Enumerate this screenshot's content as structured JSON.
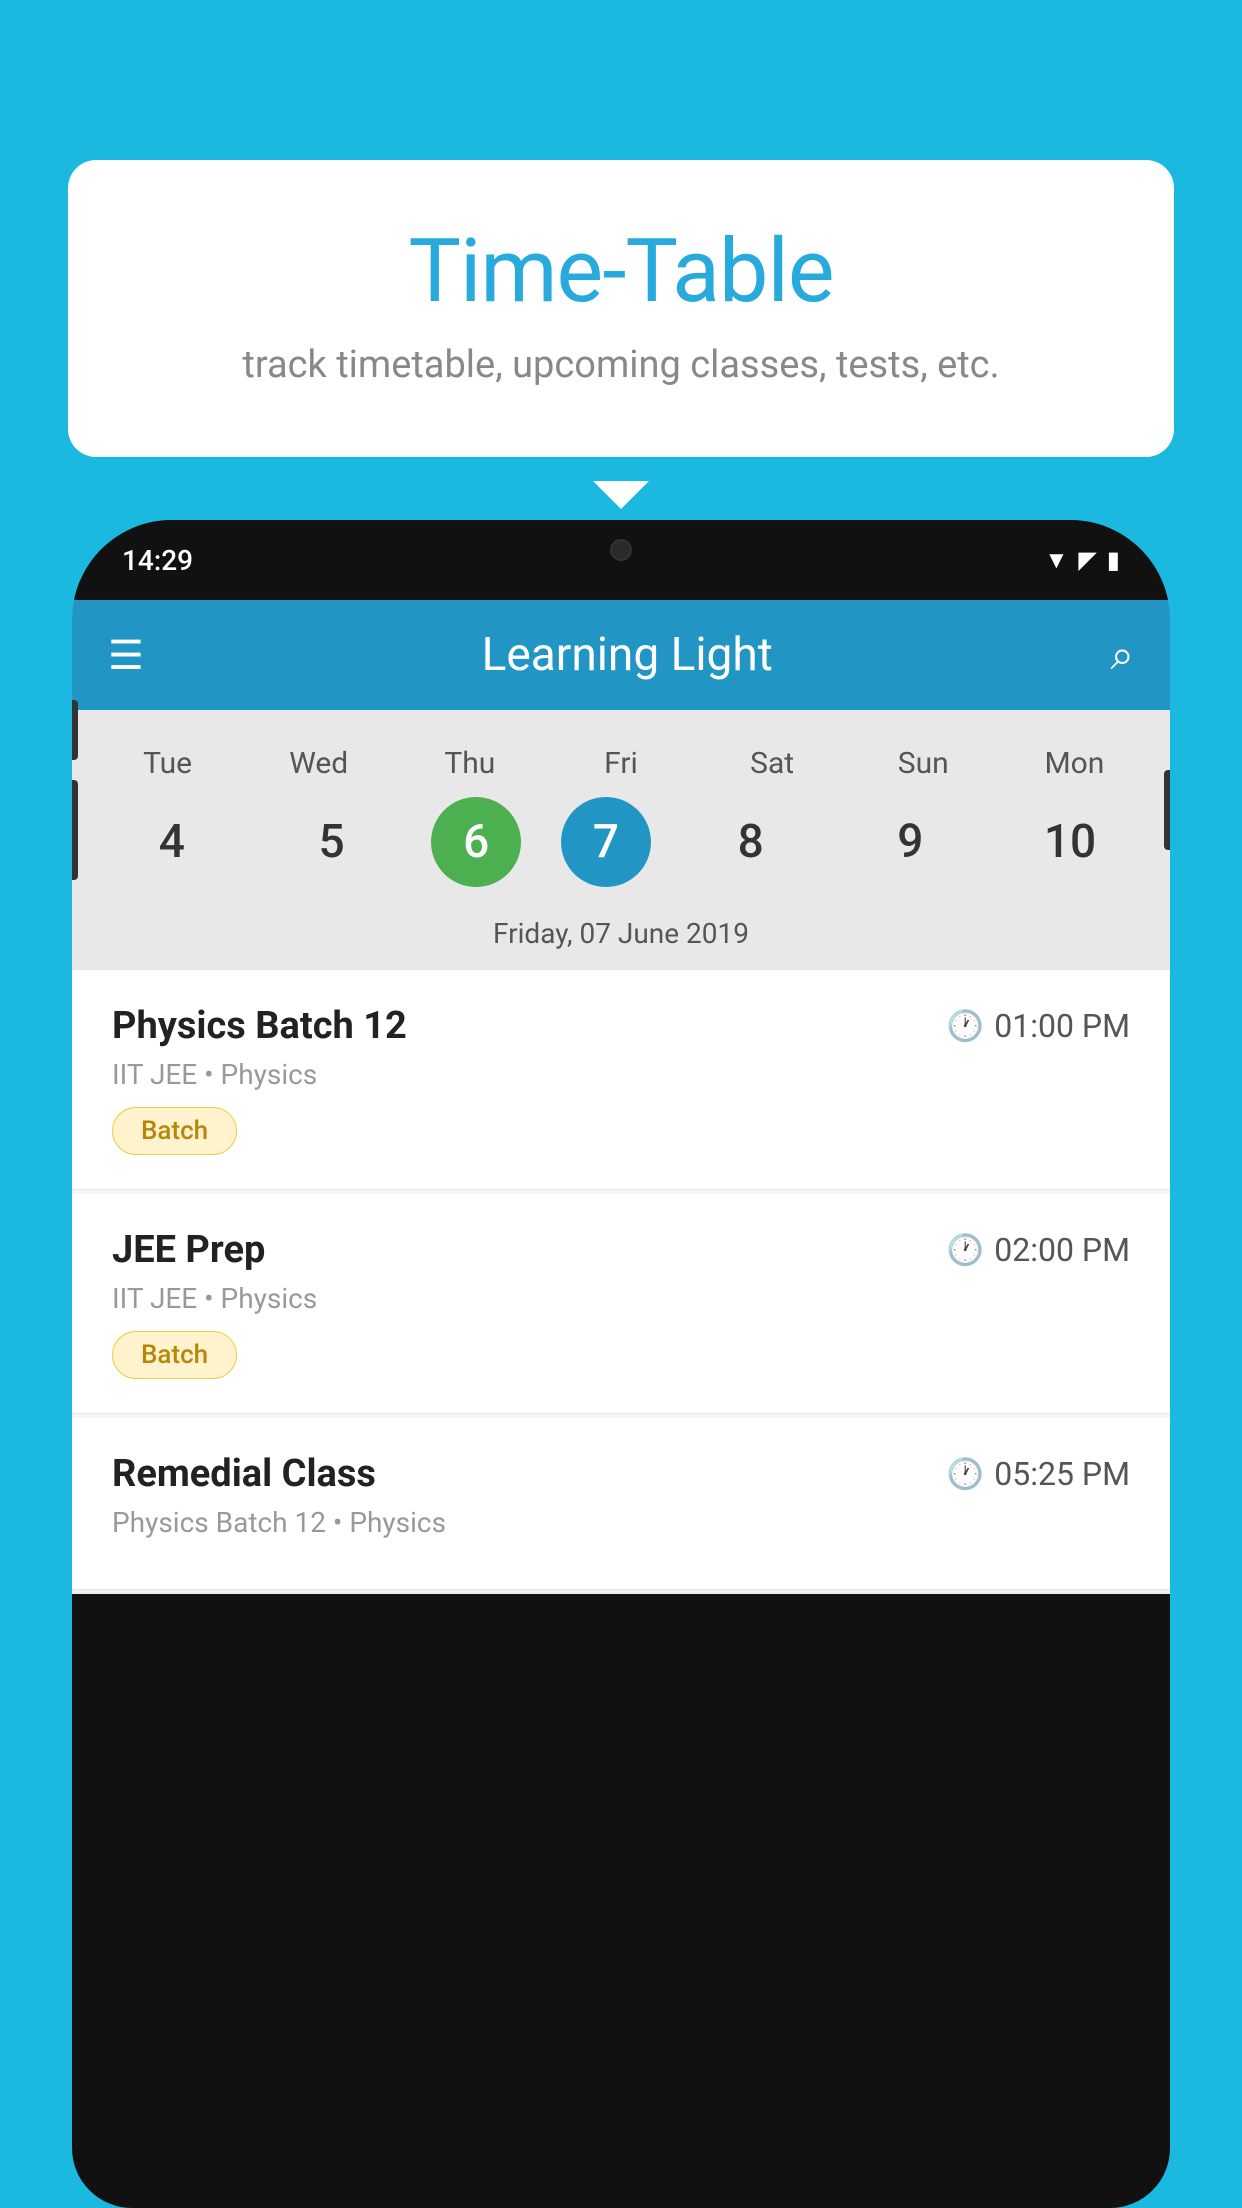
{
  "background_color": "#1BB8E0",
  "speech_bubble": {
    "title": "Time-Table",
    "subtitle": "track timetable, upcoming classes, tests, etc."
  },
  "phone": {
    "status_bar": {
      "time": "14:29",
      "icons": [
        "wifi",
        "signal",
        "battery"
      ]
    },
    "app_bar": {
      "title": "Learning Light",
      "menu_icon": "☰",
      "search_icon": "🔍"
    },
    "calendar": {
      "weekdays": [
        "Tue",
        "Wed",
        "Thu",
        "Fri",
        "Sat",
        "Sun",
        "Mon"
      ],
      "dates": [
        4,
        5,
        6,
        7,
        8,
        9,
        10
      ],
      "today_index": 2,
      "selected_index": 3,
      "selected_date_label": "Friday, 07 June 2019"
    },
    "schedule": [
      {
        "title": "Physics Batch 12",
        "time": "01:00 PM",
        "meta": "IIT JEE • Physics",
        "badge": "Batch"
      },
      {
        "title": "JEE Prep",
        "time": "02:00 PM",
        "meta": "IIT JEE • Physics",
        "badge": "Batch"
      },
      {
        "title": "Remedial Class",
        "time": "05:25 PM",
        "meta": "Physics Batch 12 • Physics",
        "badge": ""
      }
    ]
  }
}
